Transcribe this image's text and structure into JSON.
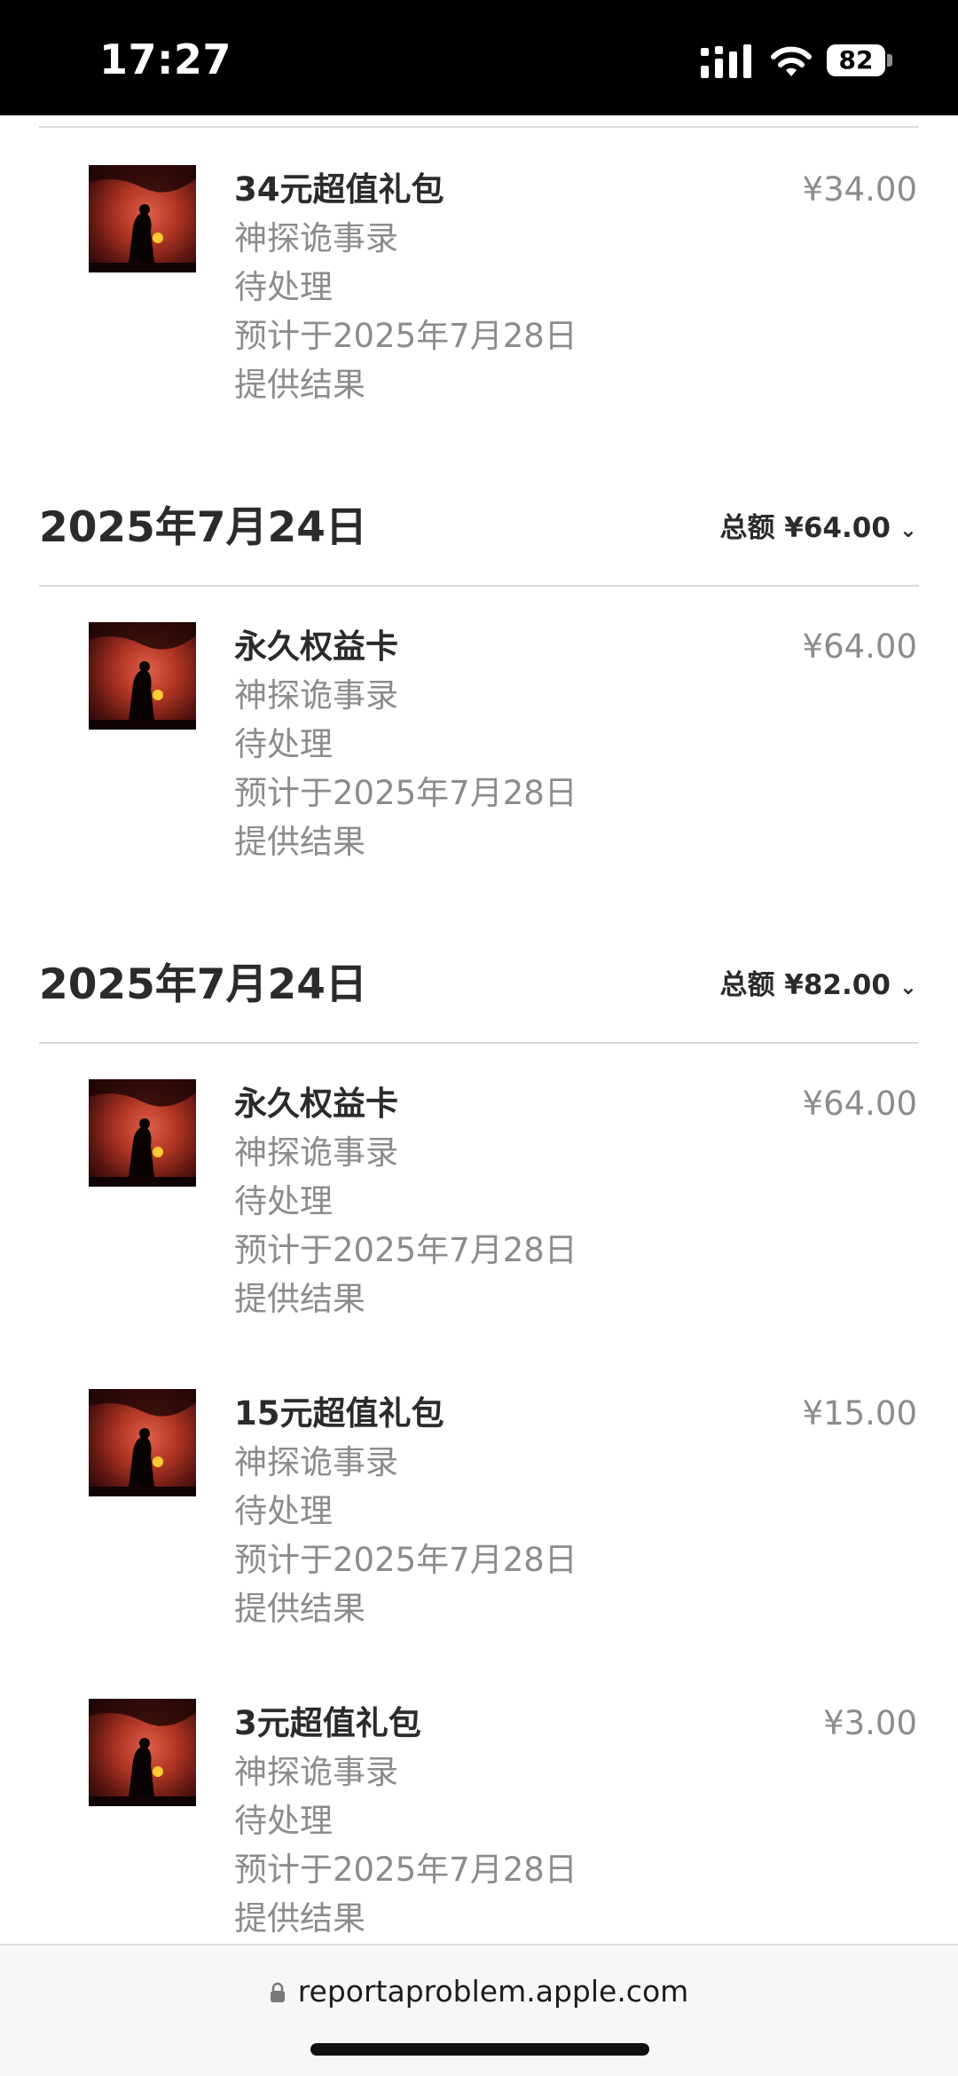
{
  "status_bar": {
    "time": "17:27",
    "battery": "82"
  },
  "top_item": {
    "title": "34元超值礼包",
    "app": "神探诡事录",
    "status": "待处理",
    "eta_line1": "预计于2025年7月28日",
    "eta_line2": "提供结果",
    "price": "¥34.00"
  },
  "groups": [
    {
      "date": "2025年7月24日",
      "total": "总额 ¥64.00",
      "items": [
        {
          "title": "永久权益卡",
          "app": "神探诡事录",
          "status": "待处理",
          "eta_line1": "预计于2025年7月28日",
          "eta_line2": "提供结果",
          "price": "¥64.00"
        }
      ]
    },
    {
      "date": "2025年7月24日",
      "total": "总额 ¥82.00",
      "items": [
        {
          "title": "永久权益卡",
          "app": "神探诡事录",
          "status": "待处理",
          "eta_line1": "预计于2025年7月28日",
          "eta_line2": "提供结果",
          "price": "¥64.00"
        },
        {
          "title": "15元超值礼包",
          "app": "神探诡事录",
          "status": "待处理",
          "eta_line1": "预计于2025年7月28日",
          "eta_line2": "提供结果",
          "price": "¥15.00"
        },
        {
          "title": "3元超值礼包",
          "app": "神探诡事录",
          "status": "待处理",
          "eta_line1": "预计于2025年7月28日",
          "eta_line2": "提供结果",
          "price": "¥3.00"
        }
      ]
    }
  ],
  "url_bar": {
    "url": "reportaproblem.apple.com"
  },
  "icons": {
    "signal": "signal-icon",
    "wifi": "wifi-icon",
    "battery": "battery-icon",
    "lock": "lock-icon",
    "chevron": "chevron-down-icon",
    "app_thumb": "game-art-thumbnail"
  },
  "colors": {
    "status_bar_bg": "#000000",
    "secondary_text": "#8c8c8c",
    "primary_text": "#2b2b2b"
  }
}
